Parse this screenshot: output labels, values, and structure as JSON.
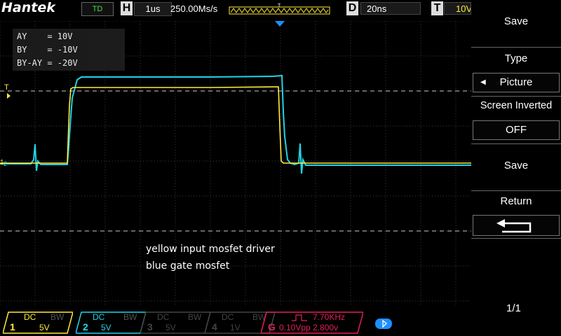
{
  "header": {
    "brand": "Hantek",
    "mode": "TD",
    "h_label": "H",
    "timebase": "1us",
    "sample_rate": "250.00Ms/s",
    "trigger_marker": "T",
    "d_label": "D",
    "delay": "20ns",
    "t_label": "T",
    "trigger_level": "10V"
  },
  "measure": {
    "lines": [
      "AY    = 10V",
      "BY    = -10V",
      "BY-AY = -20V"
    ]
  },
  "annotations": {
    "line1": "yellow input mosfet driver",
    "line2": "blue gate mosfet"
  },
  "markers": {
    "trigger_left": "T",
    "ch1": "1",
    "ch2": "2"
  },
  "sidebar": {
    "save_title": "Save",
    "type_title": "Type",
    "type_value": "Picture",
    "inverted_title": "Screen Inverted",
    "inverted_value": "OFF",
    "save_action": "Save",
    "return_title": "Return",
    "page": "1/1"
  },
  "channels": [
    {
      "num": "1",
      "coupling": "DC",
      "bw": "BW",
      "scale": "5V",
      "color": "#ffeb3b"
    },
    {
      "num": "2",
      "coupling": "DC",
      "bw": "BW",
      "scale": "5V",
      "color": "#22d3e6"
    },
    {
      "num": "3",
      "coupling": "DC",
      "bw": "BW",
      "scale": "5V",
      "color": "#444444"
    },
    {
      "num": "4",
      "coupling": "DC",
      "bw": "BW",
      "scale": "1V",
      "color": "#444444"
    }
  ],
  "generator": {
    "label": "G",
    "freq": "7.70KHz",
    "amplitude": "0.10Vpp 2.800v",
    "color": "#e0205a"
  },
  "colors": {
    "ch1": "#ffeb3b",
    "ch2": "#22d3e6",
    "grid": "#3a3a3a",
    "accent": "#1e8fff"
  }
}
